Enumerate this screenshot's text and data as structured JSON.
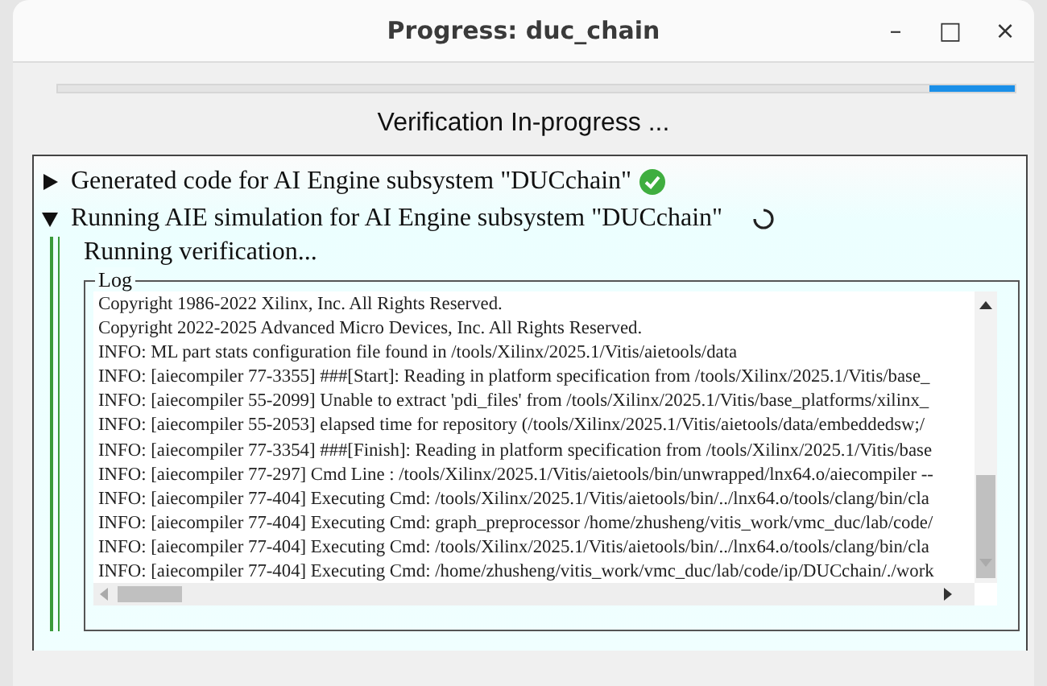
{
  "window": {
    "title": "Progress: duc_chain",
    "controls": [
      "–",
      "□",
      "×"
    ]
  },
  "progress": {
    "kind": "indeterminate"
  },
  "status": "Verification In-progress ...",
  "tasks": [
    {
      "label": "Generated code for AI Engine subsystem \"DUCchain\"",
      "expanded": false,
      "done": true
    },
    {
      "label": "Running AIE simulation for AI Engine subsystem \"DUCchain\"",
      "expanded": true,
      "done": false,
      "message": "Running verification...",
      "log": {
        "title": "Log",
        "lines": [
          "Copyright 1986-2022 Xilinx, Inc. All Rights Reserved.",
          "Copyright 2022-2025 Advanced Micro Devices, Inc. All Rights Reserved.",
          "INFO: ML part stats configuration file found in /tools/Xilinx/2025.1/Vitis/aietools/data",
          "INFO: [aiecompiler 77-3355] ###[Start]: Reading in platform specification from /tools/Xilinx/2025.1/Vitis/base_",
          "INFO: [aiecompiler 55-2099] Unable to extract 'pdi_files' from /tools/Xilinx/2025.1/Vitis/base_platforms/xilinx_",
          "INFO: [aiecompiler 55-2053] elapsed time for repository (/tools/Xilinx/2025.1/Vitis/aietools/data/embeddedsw;/",
          "INFO: [aiecompiler 77-3354] ###[Finish]: Reading in platform specification from /tools/Xilinx/2025.1/Vitis/base",
          "INFO: [aiecompiler 77-297] Cmd Line : /tools/Xilinx/2025.1/Vitis/aietools/bin/unwrapped/lnx64.o/aiecompiler --",
          "INFO: [aiecompiler 77-404] Executing Cmd: /tools/Xilinx/2025.1/Vitis/aietools/bin/../lnx64.o/tools/clang/bin/cla",
          "INFO: [aiecompiler 77-404] Executing Cmd: graph_preprocessor /home/zhusheng/vitis_work/vmc_duc/lab/code/",
          "INFO: [aiecompiler 77-404] Executing Cmd: /tools/Xilinx/2025.1/Vitis/aietools/bin/../lnx64.o/tools/clang/bin/cla",
          "INFO: [aiecompiler 77-404] Executing Cmd: /home/zhusheng/vitis_work/vmc_duc/lab/code/ip/DUCchain/./work"
        ]
      }
    }
  ]
}
